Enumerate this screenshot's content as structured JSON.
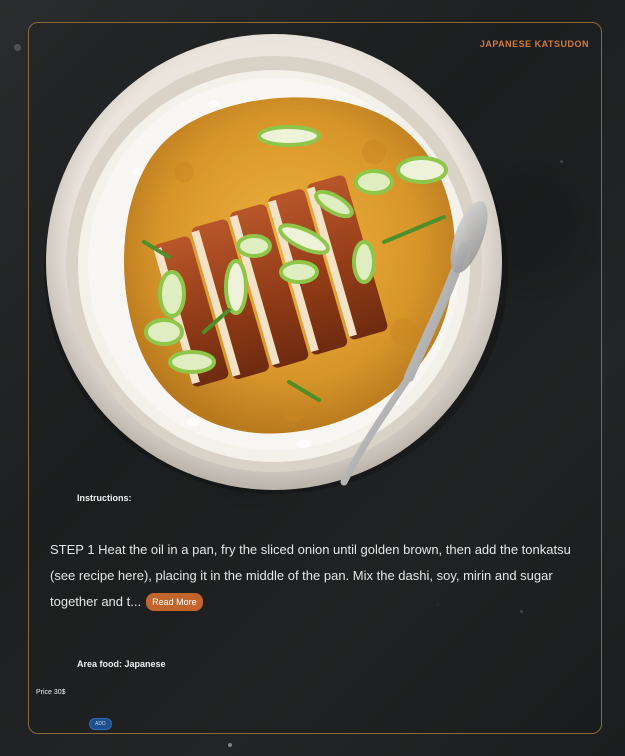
{
  "card": {
    "title": "JAPANESE KATSUDON"
  },
  "image": {
    "alt": "Japanese Katsudon"
  },
  "instructions": {
    "label": "Instructions:",
    "text": "STEP 1 Heat the oil in a pan, fry the sliced onion until golden brown, then add the tonkatsu (see recipe here), placing it in the middle of the pan. Mix the dashi, soy, mirin and sugar together and t...",
    "read_more_label": "Read More"
  },
  "area": {
    "label": "Area food: Japanese"
  },
  "price": {
    "label": "Price 30$"
  },
  "actions": {
    "add_label": "ADD"
  },
  "colors": {
    "accent": "#d07a3a",
    "read_more_bg": "#c2652c",
    "add_bg": "#1d4f8c",
    "card_border": "#8a6a3a"
  }
}
